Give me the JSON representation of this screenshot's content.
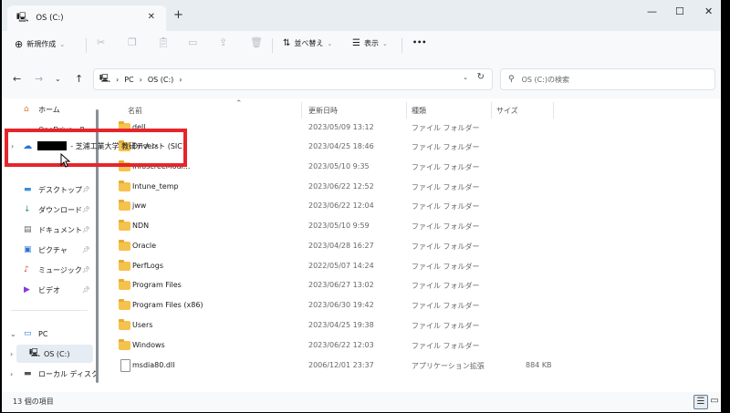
{
  "window": {
    "tab_icon": "pc-drive-icon",
    "tab_title": "OS (C:)",
    "tab_close": "✕",
    "new_tab": "+",
    "minimize": "—",
    "maximize": "☐",
    "close": "✕"
  },
  "toolbar": {
    "new_label": "新規作成",
    "sort_label": "並べ替え",
    "view_label": "表示",
    "more_label": "•••"
  },
  "address": {
    "pc": "PC",
    "sep": "›",
    "drive": "OS (C:)",
    "sep2": "›",
    "search_placeholder": "OS (C:)の検索"
  },
  "nav": {
    "home": "ホーム",
    "onedrive_personal": "OneDrive - P...",
    "onedrive_org": "- 芝浦工業大学 教研テナント (SIC)",
    "desktop": "デスクトップ",
    "downloads": "ダウンロード",
    "documents": "ドキュメント",
    "pictures": "ピクチャ",
    "music": "ミュージック",
    "videos": "ビデオ",
    "pc": "PC",
    "os_c": "OS (C:)",
    "local_disk": "ローカル ディスク"
  },
  "columns": {
    "name": "名前",
    "date": "更新日時",
    "type": "種類",
    "size": "サイズ"
  },
  "files": [
    {
      "name": "dell",
      "date": "2023/05/09 13:12",
      "type": "ファイル フォルダー",
      "size": ""
    },
    {
      "name": "Drivers",
      "date": "2023/04/25 18:46",
      "type": "ファイル フォルダー",
      "size": ""
    },
    {
      "name": "InfoscreeModi...",
      "date": "2023/05/10 9:35",
      "type": "ファイル フォルダー",
      "size": ""
    },
    {
      "name": "Intune_temp",
      "date": "2023/06/22 12:52",
      "type": "ファイル フォルダー",
      "size": ""
    },
    {
      "name": "jww",
      "date": "2023/06/22 12:04",
      "type": "ファイル フォルダー",
      "size": ""
    },
    {
      "name": "NDN",
      "date": "2023/05/10 9:59",
      "type": "ファイル フォルダー",
      "size": ""
    },
    {
      "name": "Oracle",
      "date": "2023/04/28 16:27",
      "type": "ファイル フォルダー",
      "size": ""
    },
    {
      "name": "PerfLogs",
      "date": "2022/05/07 14:24",
      "type": "ファイル フォルダー",
      "size": ""
    },
    {
      "name": "Program Files",
      "date": "2023/06/27 13:02",
      "type": "ファイル フォルダー",
      "size": ""
    },
    {
      "name": "Program Files (x86)",
      "date": "2023/06/30 19:42",
      "type": "ファイル フォルダー",
      "size": ""
    },
    {
      "name": "Users",
      "date": "2023/04/25 19:38",
      "type": "ファイル フォルダー",
      "size": ""
    },
    {
      "name": "Windows",
      "date": "2023/06/22 12:03",
      "type": "ファイル フォルダー",
      "size": ""
    },
    {
      "name": "msdia80.dll",
      "date": "2006/12/01 23:37",
      "type": "アプリケーション拡張",
      "size": "884 KB"
    }
  ],
  "status": {
    "count": "13 個の項目"
  }
}
